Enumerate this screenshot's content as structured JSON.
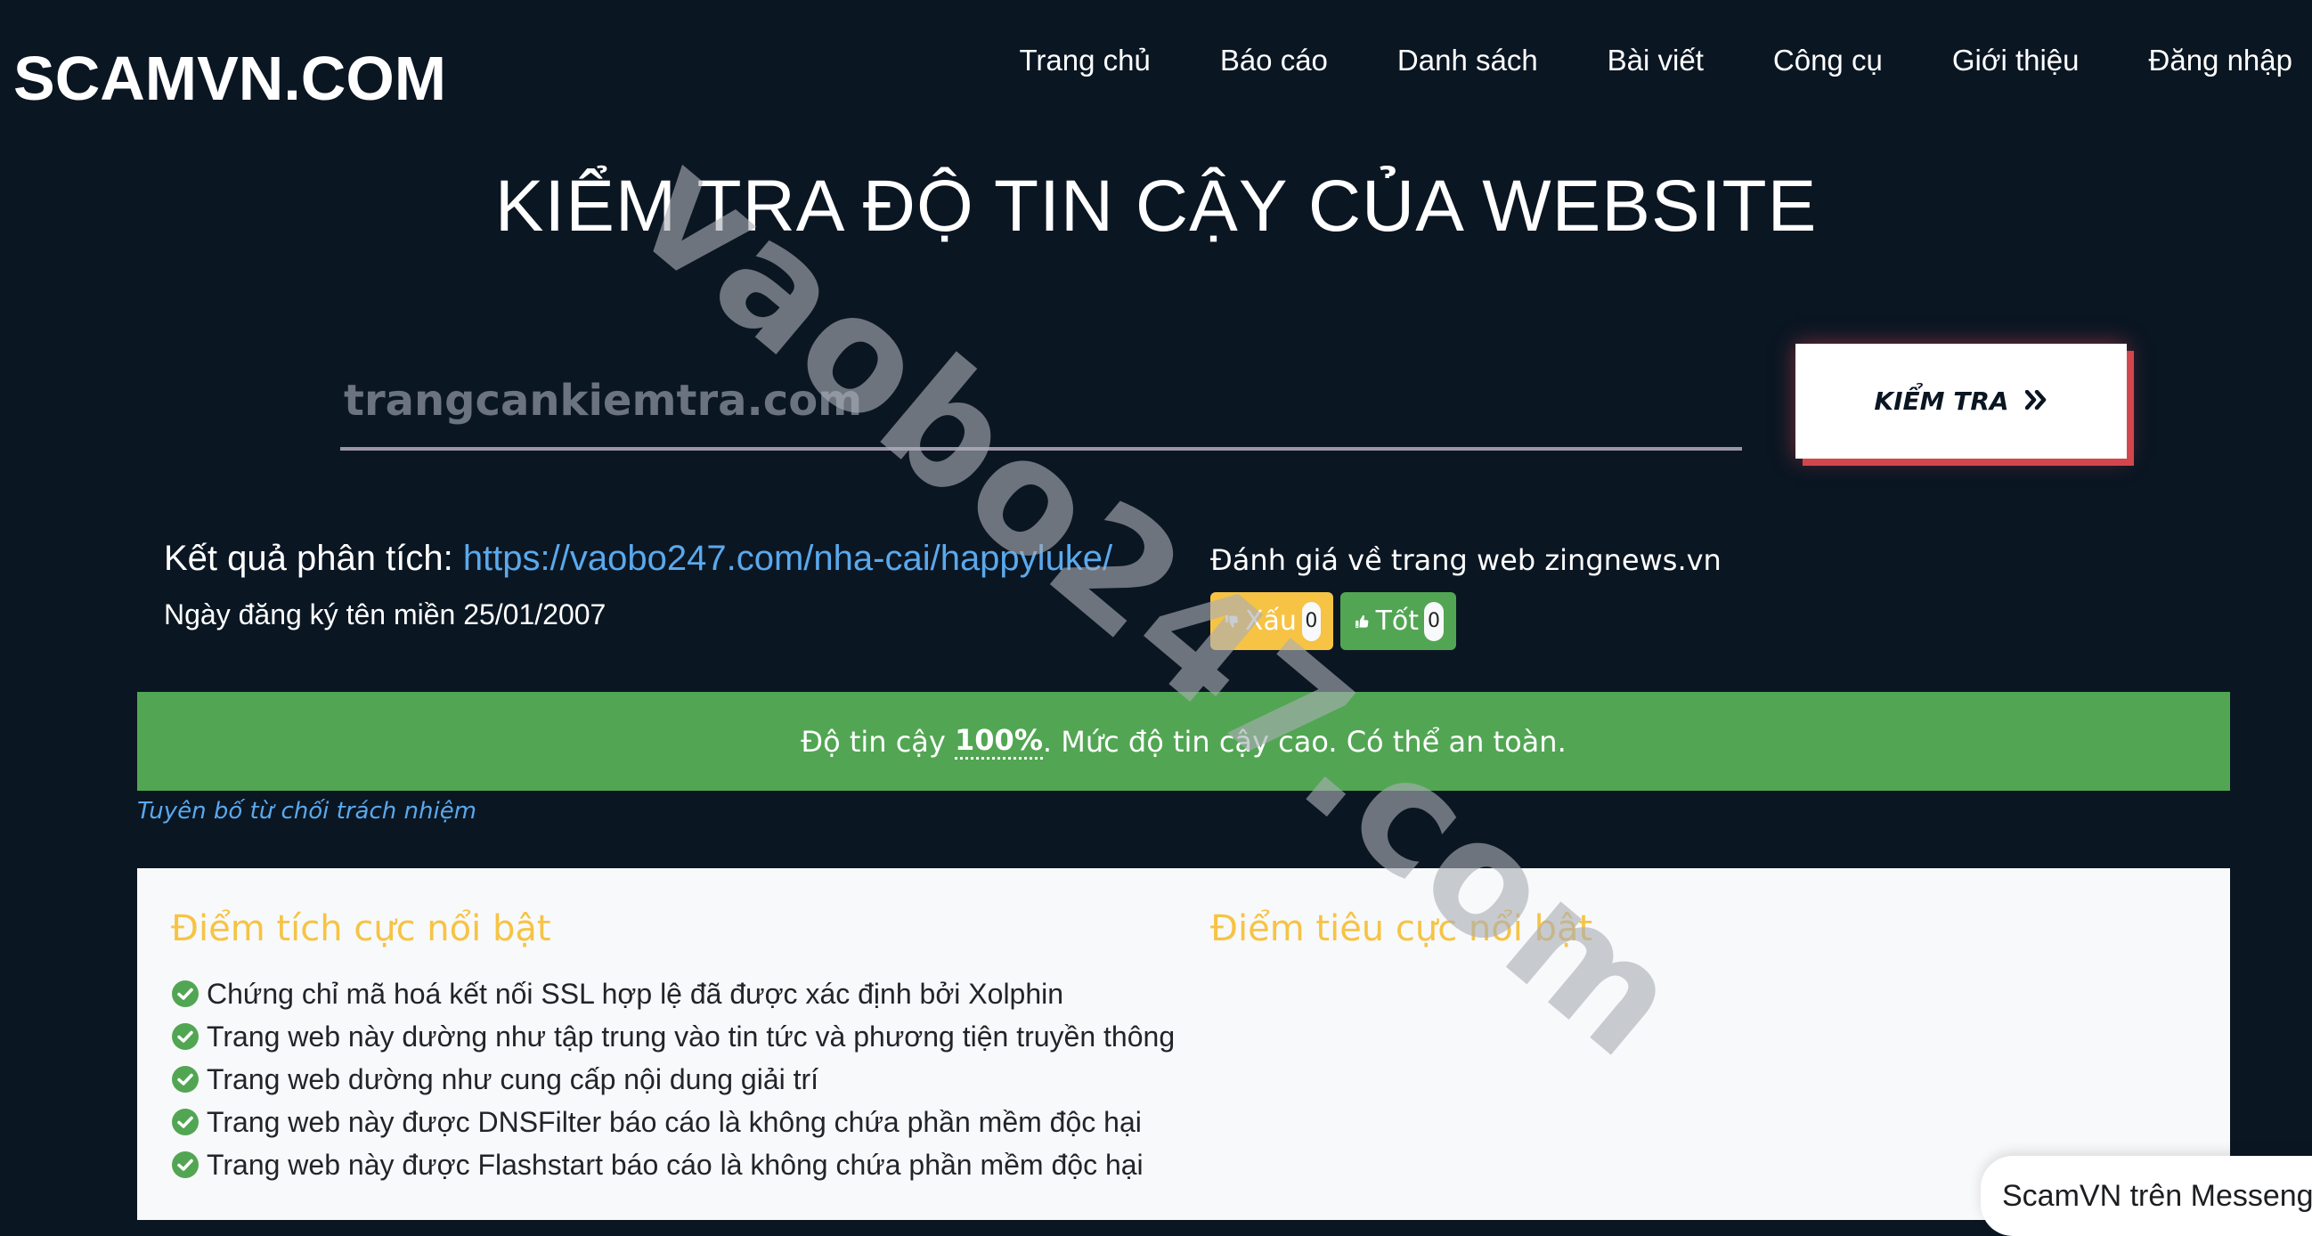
{
  "header": {
    "logo": "SCAMVN.COM",
    "nav": [
      "Trang chủ",
      "Báo cáo",
      "Danh sách",
      "Bài viết",
      "Công cụ",
      "Giới thiệu",
      "Đăng nhập"
    ]
  },
  "main": {
    "title": "KIỂM TRA ĐỘ TIN CẬY CỦA WEBSITE",
    "search": {
      "placeholder": "trangcankiemtra.com",
      "value": "",
      "button_label": "KIỂM TRA",
      "button_icon": "double-chevron-right-icon"
    },
    "result": {
      "label": "Kết quả phân tích:",
      "url": "https://vaobo247.com/nha-cai/happyluke/",
      "registration": "Ngày đăng ký tên miền 25/01/2007"
    },
    "rating": {
      "title": "Đánh giá về trang web zingnews.vn",
      "bad": {
        "label": "Xấu",
        "count": "0",
        "icon": "thumbs-down-icon"
      },
      "good": {
        "label": "Tốt",
        "count": "0",
        "icon": "thumbs-up-icon"
      }
    },
    "trust": {
      "prefix": "Độ tin cậy",
      "percent": "100%",
      "suffix": ". Mức độ tin cậy cao. Có thể an toàn."
    },
    "disclaimer": "Tuyên bố từ chối trách nhiệm",
    "positive": {
      "heading": "Điểm tích cực nổi bật",
      "items": [
        "Chứng chỉ mã hoá kết nối SSL hợp lệ đã được xác định bởi Xolphin",
        "Trang web này dường như tập trung vào tin tức và phương tiện truyền thông",
        "Trang web dường như cung cấp nội dung giải trí",
        "Trang web này được DNSFilter báo cáo là không chứa phần mềm độc hại",
        "Trang web này được Flashstart báo cáo là không chứa phần mềm độc hại"
      ]
    },
    "negative": {
      "heading": "Điểm tiêu cực nổi bật",
      "items": []
    }
  },
  "messenger": {
    "label": "ScamVN trên Messenger"
  },
  "watermark": "vaobo247.com",
  "colors": {
    "background": "#0b1623",
    "accent_yellow": "#f6c344",
    "success_green": "#52a653",
    "link_blue": "#5aa9ec",
    "button_red": "#d4464d"
  }
}
